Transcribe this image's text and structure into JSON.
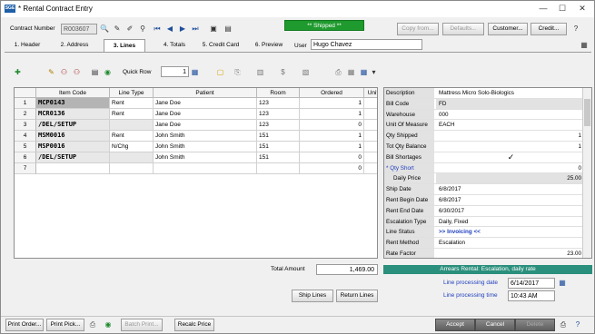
{
  "window": {
    "title": "* Rental Contract Entry"
  },
  "header": {
    "contract_number_label": "Contract Number",
    "contract_number": "R003607",
    "status": "** Shipped **",
    "buttons": {
      "copy_from": "Copy from...",
      "defaults": "Defaults...",
      "customer": "Customer...",
      "credit": "Credit..."
    }
  },
  "tabs": [
    {
      "label": "1. Header"
    },
    {
      "label": "2. Address"
    },
    {
      "label": "3. Lines"
    },
    {
      "label": "4. Totals"
    },
    {
      "label": "5. Credit Card"
    },
    {
      "label": "6. Preview"
    }
  ],
  "user": {
    "label": "User",
    "value": "Hugo Chavez"
  },
  "toolbar": {
    "quick_row_label": "Quick Row",
    "quick_row_value": "1"
  },
  "grid": {
    "columns": [
      "Item Code",
      "Line Type",
      "Patient",
      "Room",
      "Ordered",
      "Unit"
    ],
    "rows": [
      {
        "n": "1",
        "code": "MCP0143",
        "type": "Rent",
        "patient": "Jane Doe",
        "room": "123",
        "ordered": "1"
      },
      {
        "n": "2",
        "code": "MCR0136",
        "type": "Rent",
        "patient": "Jane Doe",
        "room": "123",
        "ordered": "1"
      },
      {
        "n": "3",
        "code": "/DEL/SETUP",
        "type": "",
        "patient": "Jane Doe",
        "room": "123",
        "ordered": "0"
      },
      {
        "n": "4",
        "code": "MSM0016",
        "type": "Rent",
        "patient": "John Smith",
        "room": "151",
        "ordered": "1"
      },
      {
        "n": "5",
        "code": "MSP0016",
        "type": "N/Chg",
        "patient": "John Smith",
        "room": "151",
        "ordered": "1"
      },
      {
        "n": "6",
        "code": "/DEL/SETUP",
        "type": "",
        "patient": "John Smith",
        "room": "151",
        "ordered": "0"
      },
      {
        "n": "7",
        "code": "",
        "type": "",
        "patient": "",
        "room": "",
        "ordered": "0"
      }
    ]
  },
  "properties": [
    {
      "name": "Description",
      "value": "Mattress Micro Solo-Biologics"
    },
    {
      "name": "Bill Code",
      "value": "FD"
    },
    {
      "name": "Warehouse",
      "value": "000"
    },
    {
      "name": "Unit Of Measure",
      "value": "EACH"
    },
    {
      "name": "Qty Shipped",
      "value": "1"
    },
    {
      "name": "Tot Qty Balance",
      "value": "1"
    },
    {
      "name": "Bill Shortages",
      "value": "✓"
    },
    {
      "name": "* Qty Short",
      "value": "0"
    },
    {
      "name": "Daily Price",
      "value": "25.00"
    },
    {
      "name": "Ship Date",
      "value": "6/8/2017"
    },
    {
      "name": "Rent Begin Date",
      "value": "6/8/2017"
    },
    {
      "name": "Rent End Date",
      "value": "6/30/2017"
    },
    {
      "name": "Escalation Type",
      "value": "Daily, Fixed"
    },
    {
      "name": "Line Status",
      "value": ">> Invoicing <<"
    },
    {
      "name": "Rent Method",
      "value": "Escalation"
    },
    {
      "name": "Rate Factor",
      "value": "23.00"
    }
  ],
  "totals": {
    "label": "Total Amount",
    "value": "1,469.00"
  },
  "arrears": "Arrears Rental:  Escalation, daily rate",
  "processing": {
    "date_label": "Line processing date",
    "date_value": "6/14/2017",
    "time_label": "Line processing time",
    "time_value": "10:43 AM"
  },
  "actions": {
    "ship_lines": "Ship Lines",
    "return_lines": "Return Lines"
  },
  "footer": {
    "print_order": "Print Order...",
    "print_pick": "Print Pick...",
    "batch_print": "Batch Print...",
    "recalc_price": "Recalc Price",
    "accept": "Accept",
    "cancel": "Cancel",
    "delete": "Delete"
  },
  "colors": {
    "status_green": "#1f9a2e",
    "arrears_teal": "#2a8f7c",
    "accent_blue": "#1f3fbf"
  }
}
